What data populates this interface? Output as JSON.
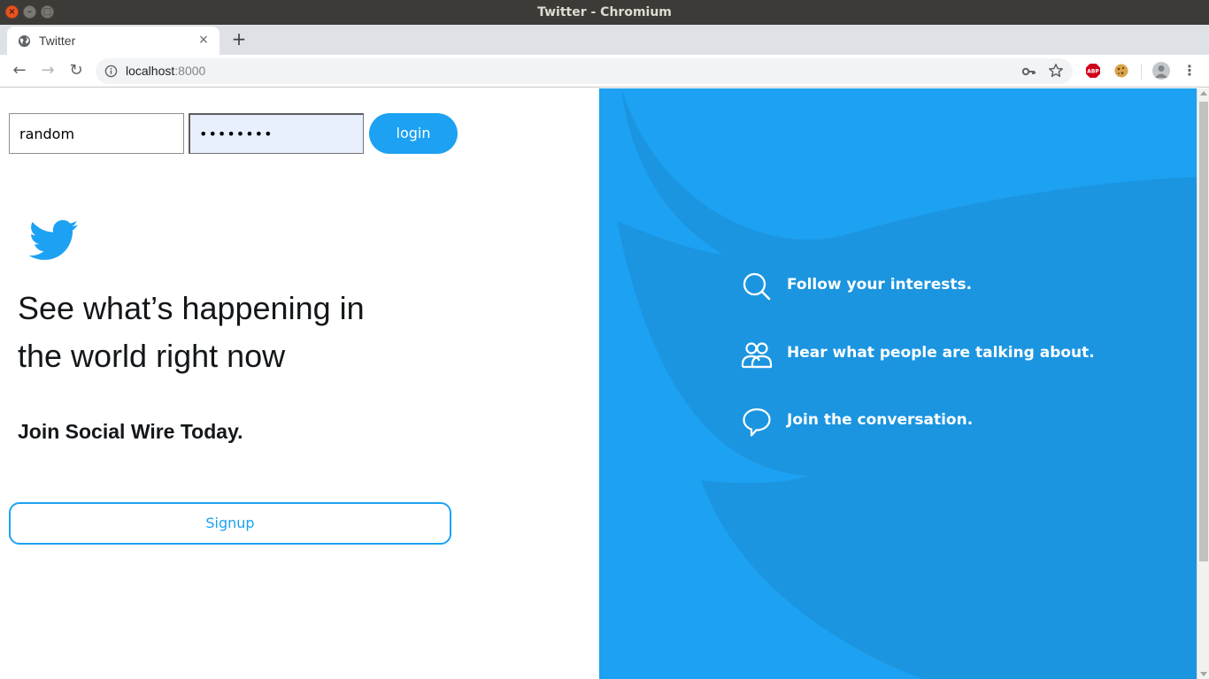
{
  "window": {
    "title": "Twitter - Chromium",
    "close_glyph": "×",
    "minimize_glyph": "–",
    "maximize_glyph": "□"
  },
  "tabs": [
    {
      "title": "Twitter",
      "icon": "globe-icon",
      "close_glyph": "×"
    }
  ],
  "new_tab_glyph": "+",
  "toolbar": {
    "back_glyph": "←",
    "forward_glyph": "→",
    "reload_glyph": "↻",
    "url_host": "localhost",
    "url_port": ":8000",
    "menu_glyph": "⋮",
    "extensions": [
      "adblock-plus-icon",
      "cookie-icon"
    ]
  },
  "login": {
    "username_value": "random",
    "password_value": "••••••••",
    "button_label": "login"
  },
  "hero": {
    "headline_line1": "See what’s happening in",
    "headline_line2": "the world right now",
    "join_text": "Join Social Wire Today.",
    "signup_label": "Signup"
  },
  "features": [
    {
      "icon": "search-icon",
      "text": "Follow your interests."
    },
    {
      "icon": "people-icon",
      "text": "Hear what people are talking about."
    },
    {
      "icon": "speech-bubble-icon",
      "text": "Join the conversation."
    }
  ],
  "colors": {
    "brand_blue": "#1da1f2",
    "brand_blue_dark": "#1b95e0",
    "autofill_bg": "#e8f0fe",
    "titlebar_bg": "#3c3b37"
  }
}
